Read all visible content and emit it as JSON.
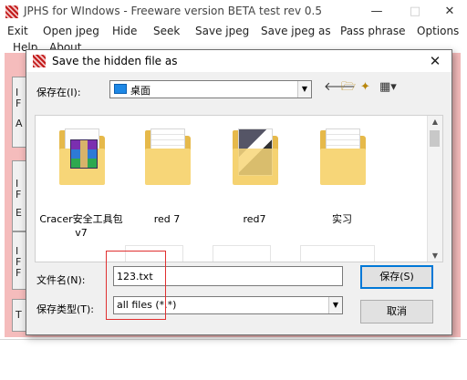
{
  "app": {
    "title": "JPHS for WIndows - Freeware version BETA test rev 0.5",
    "menu": [
      "Exit",
      "Open jpeg",
      "Hide",
      "Seek",
      "Save jpeg",
      "Save jpeg as",
      "Pass phrase",
      "Options"
    ],
    "menu_row2": [
      "Help",
      "About"
    ],
    "left_letters": [
      "I",
      "F",
      "A",
      "I",
      "F",
      "E",
      "I",
      "F",
      "F",
      "T"
    ]
  },
  "dialog": {
    "title": "Save the hidden file as",
    "save_in_label": "保存在(I):",
    "location": "桌面",
    "files": [
      {
        "label": "Cracer安全工具包 v7",
        "kind": "winrar"
      },
      {
        "label": "red 7",
        "kind": "doc"
      },
      {
        "label": "red7",
        "kind": "photo"
      },
      {
        "label": "实习",
        "kind": "doc"
      }
    ],
    "filename_label": "文件名(N):",
    "filename_value": "123.txt",
    "filetype_label": "保存类型(T):",
    "filetype_value": "all files (*.*)",
    "save_button": "保存(S)",
    "cancel_button": "取消"
  },
  "icons": {
    "back": "back-arrow-icon",
    "up": "up-folder-icon",
    "new_folder": "new-folder-icon",
    "view_menu": "view-menu-icon"
  },
  "colors": {
    "app_body": "#f5bcbc",
    "save_button_border": "#0078d7",
    "highlight": "#e03030",
    "folder": "#f7d678"
  }
}
